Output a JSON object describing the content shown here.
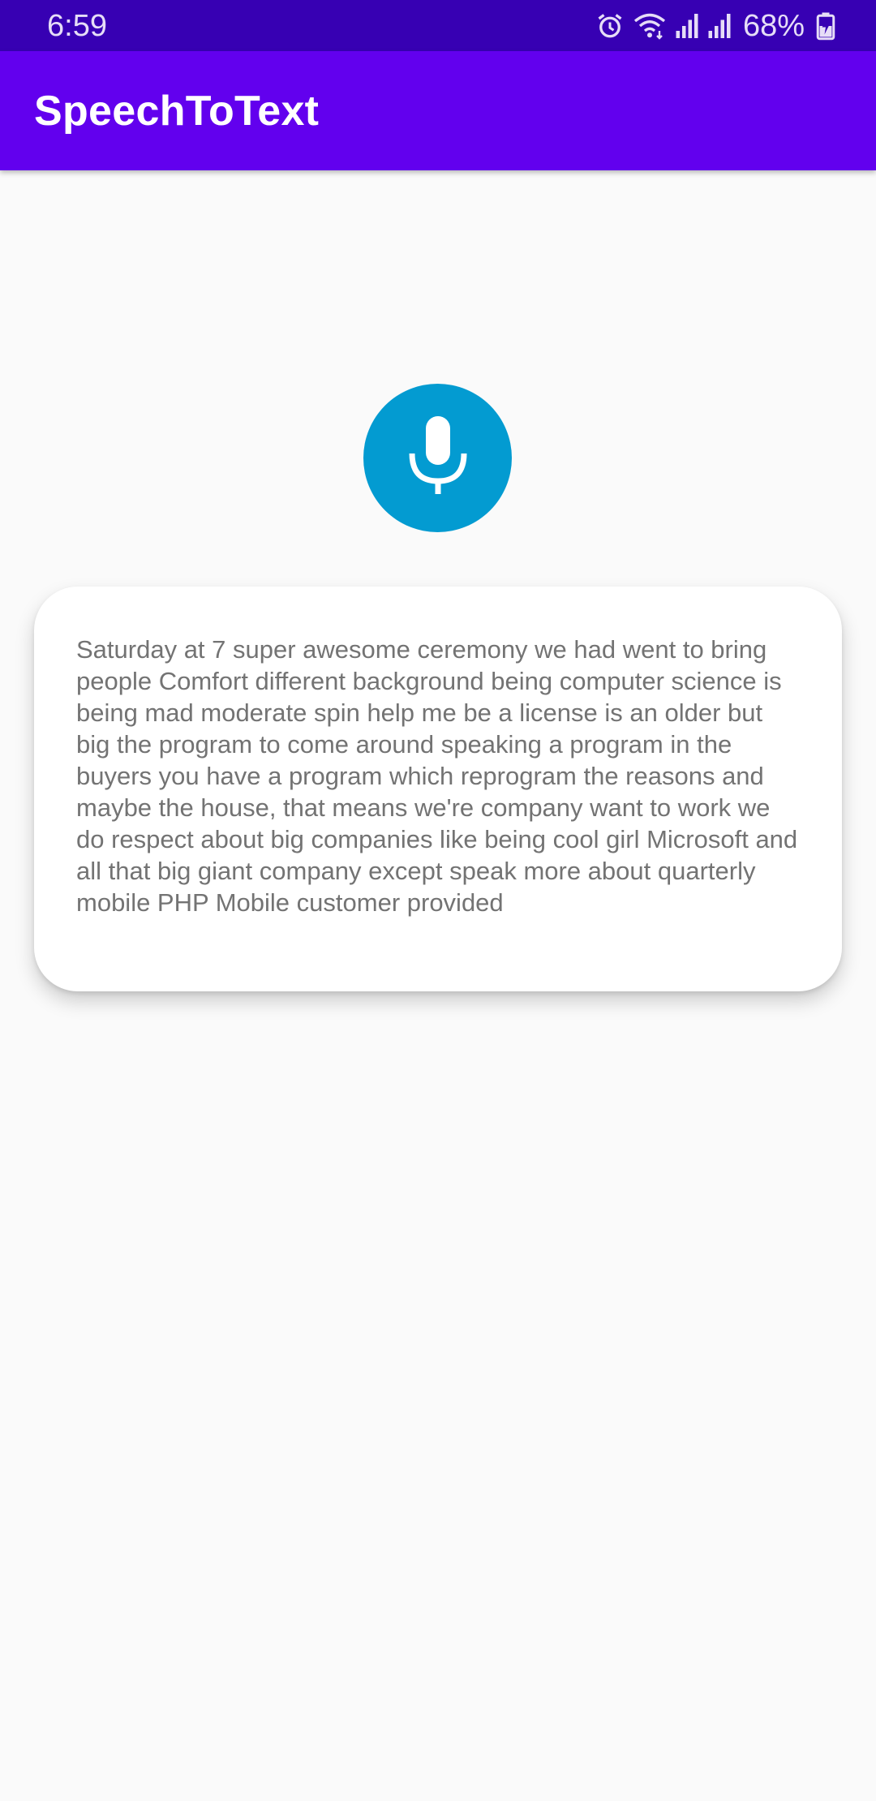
{
  "status_bar": {
    "time": "6:59",
    "battery": "68%",
    "icons": [
      "alarm-icon",
      "wifi-icon",
      "signal-icon",
      "signal-icon",
      "battery-charging-icon"
    ]
  },
  "app_bar": {
    "title": "SpeechToText",
    "color": "#6200ee"
  },
  "mic_button": {
    "icon": "mic-icon",
    "color": "#039bd1"
  },
  "result": {
    "text": "Saturday at 7 super awesome ceremony we had went to bring people Comfort different background being computer science is being mad moderate spin help me be a license is an older but big the program to come around speaking a program in the buyers you have a program which reprogram the reasons and maybe the house, that means we're company want to work we do respect about big companies like being cool girl Microsoft and all that big giant company except speak more about quarterly mobile PHP Mobile customer provided"
  }
}
